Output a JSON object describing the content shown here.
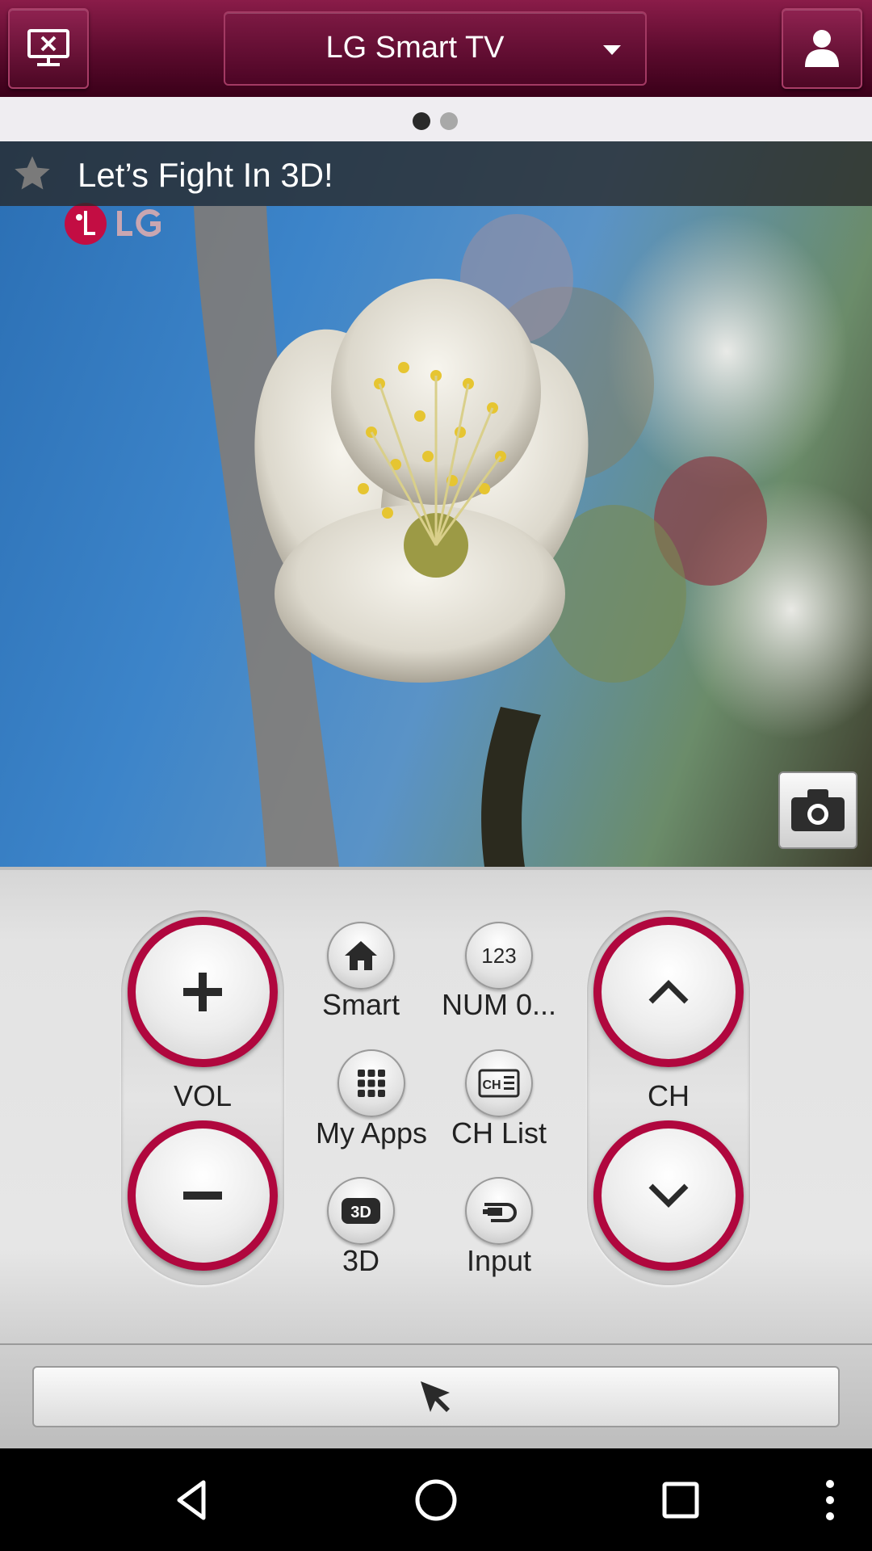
{
  "header": {
    "device_selector_label": "LG Smart TV",
    "left_icon": "tv-disconnect-icon",
    "right_icon": "user-profile-icon"
  },
  "pager": {
    "current_page": 1,
    "total_pages": 2
  },
  "media": {
    "title": "Let’s Fight In 3D!",
    "favorite_icon": "star-icon",
    "capture_icon": "camera-icon"
  },
  "remote": {
    "volume": {
      "label": "VOL",
      "up_icon": "plus-icon",
      "down_icon": "minus-icon"
    },
    "channel": {
      "label": "CH",
      "up_icon": "chevron-up-icon",
      "down_icon": "chevron-down-icon"
    },
    "buttons": [
      {
        "label": "Smart",
        "icon": "home-icon"
      },
      {
        "label": "NUM 0...",
        "icon": "num-123-icon"
      },
      {
        "label": "My Apps",
        "icon": "grid-icon"
      },
      {
        "label": "CH List",
        "icon": "channel-list-icon"
      },
      {
        "label": "3D",
        "icon": "3d-icon"
      },
      {
        "label": "Input",
        "icon": "input-icon"
      }
    ]
  },
  "pointer": {
    "icon": "cursor-icon"
  },
  "colors": {
    "accent": "#b0073e",
    "header": "#5a0a2c"
  }
}
